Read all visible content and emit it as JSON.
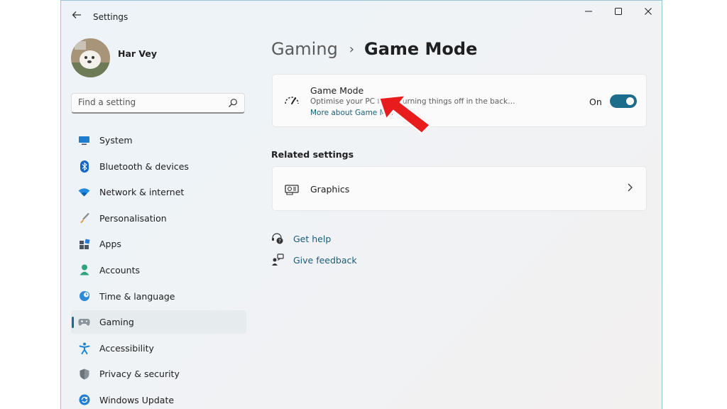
{
  "window": {
    "title": "Settings"
  },
  "user": {
    "name": "Har Vey"
  },
  "search": {
    "placeholder": "Find a setting"
  },
  "nav": {
    "items": [
      {
        "label": "System",
        "icon": "monitor-icon"
      },
      {
        "label": "Bluetooth & devices",
        "icon": "bluetooth-icon"
      },
      {
        "label": "Network & internet",
        "icon": "wifi-icon"
      },
      {
        "label": "Personalisation",
        "icon": "brush-icon"
      },
      {
        "label": "Apps",
        "icon": "apps-icon"
      },
      {
        "label": "Accounts",
        "icon": "person-icon"
      },
      {
        "label": "Time & language",
        "icon": "globe-clock-icon"
      },
      {
        "label": "Gaming",
        "icon": "gamepad-icon",
        "active": true
      },
      {
        "label": "Accessibility",
        "icon": "accessibility-icon"
      },
      {
        "label": "Privacy & security",
        "icon": "shield-icon"
      },
      {
        "label": "Windows Update",
        "icon": "update-icon"
      }
    ]
  },
  "breadcrumb": {
    "parent": "Gaming",
    "separator": "›",
    "current": "Game Mode"
  },
  "game_mode": {
    "title": "Game Mode",
    "description": "Optimise your PC f… … turning things off in the back…",
    "link": "More about Game M…",
    "state_label": "On",
    "enabled": true
  },
  "related": {
    "heading": "Related settings",
    "items": [
      {
        "label": "Graphics",
        "icon": "graphics-card-icon"
      }
    ]
  },
  "help": {
    "get_help": "Get help",
    "give_feedback": "Give feedback"
  },
  "colors": {
    "accent": "#1c6d8b",
    "link": "#1a5c78",
    "annotation_arrow": "#e81e1e"
  }
}
